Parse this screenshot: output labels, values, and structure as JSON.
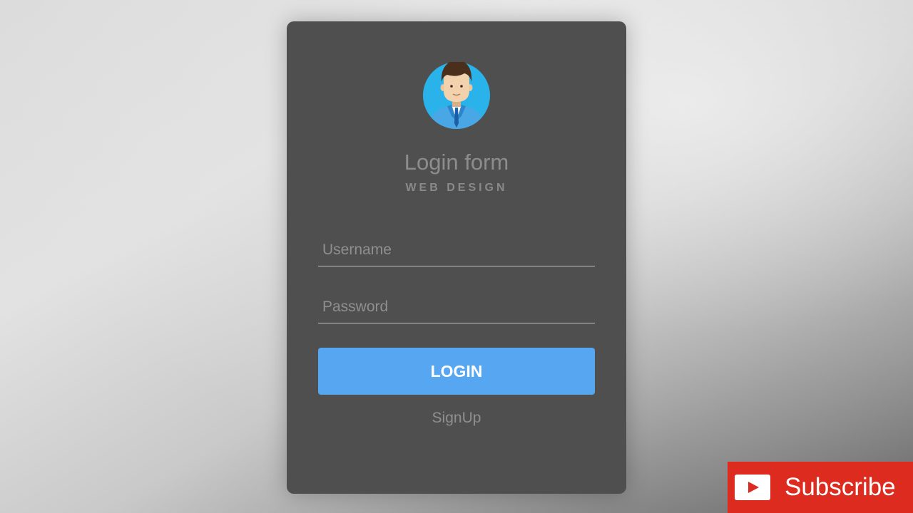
{
  "form": {
    "title": "Login form",
    "subtitle": "WEB DESIGN",
    "username_placeholder": "Username",
    "password_placeholder": "Password",
    "login_label": "LOGIN",
    "signup_label": "SignUp",
    "avatar_icon": "user-avatar-icon",
    "colors": {
      "card": "#4f4f4f",
      "button": "#56a6f2",
      "avatar_circle": "#2ab3ea"
    }
  },
  "overlay": {
    "subscribe_label": "Subscribe",
    "icon": "youtube-play-icon",
    "color": "#de2b1f"
  }
}
